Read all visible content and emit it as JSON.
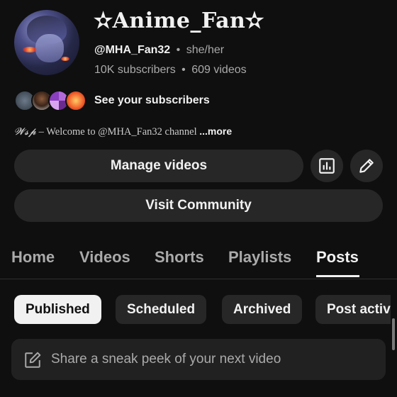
{
  "channel": {
    "name": "✫Anime_Fan✫",
    "handle": "@MHA_Fan32",
    "pronouns": "she/her",
    "subscribers": "10K subscribers",
    "videos": "609 videos",
    "see_subscribers": "See your subscribers",
    "description_prefix": "𝓦𝓼𝓹",
    "description_body": " – Welcome to @MHA_Fan32 channel ",
    "description_more": "...more"
  },
  "actions": {
    "manage_videos": "Manage videos",
    "visit_community": "Visit Community",
    "analytics_icon": "analytics-icon",
    "edit_icon": "pencil-icon"
  },
  "tabs": [
    "Home",
    "Videos",
    "Shorts",
    "Playlists",
    "Posts"
  ],
  "active_tab": "Posts",
  "filters": [
    "Published",
    "Scheduled",
    "Archived",
    "Post activ"
  ],
  "active_filter": "Published",
  "composer": {
    "placeholder": "Share a sneak peek of your next video",
    "icon": "edit-square-icon"
  },
  "colors": {
    "background": "#0f0f0f",
    "surface": "#272727",
    "text_primary": "#f1f1f1",
    "text_secondary": "#aaaaaa"
  }
}
